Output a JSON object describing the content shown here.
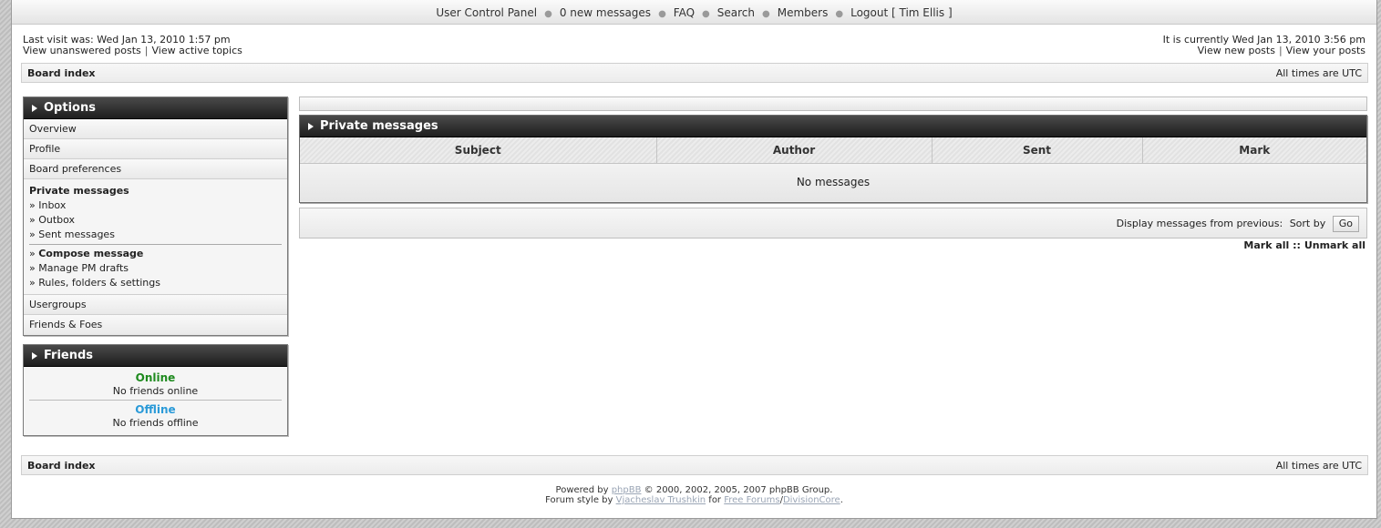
{
  "topnav": {
    "items": [
      "User Control Panel",
      "0 new messages",
      "FAQ",
      "Search",
      "Members",
      "Logout [ Tim Ellis ]"
    ]
  },
  "info": {
    "last_visit": "Last visit was: Wed Jan 13, 2010 1:57 pm",
    "unanswered": "View unanswered posts",
    "active": "View active topics",
    "current_time": "It is currently Wed Jan 13, 2010 3:56 pm",
    "new_posts": "View new posts",
    "your_posts": "View your posts"
  },
  "crumb": {
    "board_index": "Board index",
    "times": "All times are UTC"
  },
  "options": {
    "title": "Options",
    "items": [
      "Overview",
      "Profile",
      "Board preferences"
    ],
    "pm_title": "Private messages",
    "pm_links": [
      "» Inbox",
      "» Outbox",
      "» Sent messages"
    ],
    "pm_compose": "Compose message",
    "pm_links2": [
      "» Manage PM drafts",
      "» Rules, folders & settings"
    ],
    "items2": [
      "Usergroups",
      "Friends & Foes"
    ]
  },
  "friends": {
    "title": "Friends",
    "online": "Online",
    "no_online": "No friends online",
    "offline": "Offline",
    "no_offline": "No friends offline"
  },
  "pm": {
    "title": "Private messages",
    "columns": [
      "Subject",
      "Author",
      "Sent",
      "Mark"
    ],
    "empty": "No messages",
    "display_label": "Display messages from previous:",
    "sort_label": "Sort by",
    "go": "Go",
    "mark_all": "Mark all",
    "sep": "::",
    "unmark_all": "Unmark all"
  },
  "footer": {
    "powered": "Powered by",
    "phpbb": "phpBB",
    "copy": "© 2000, 2002, 2005, 2007 phpBB Group.",
    "style": "Forum style by",
    "author": "Vjacheslav Trushkin",
    "for": "for",
    "free_forums": "Free Forums",
    "slash": "/",
    "division": "DivisionCore",
    "dot": "."
  }
}
